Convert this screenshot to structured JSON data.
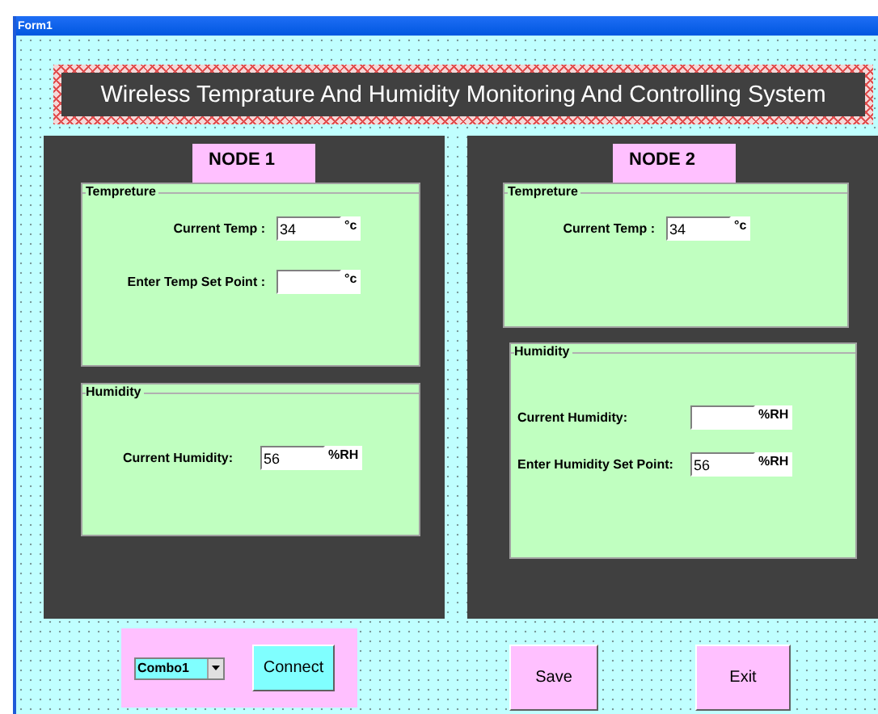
{
  "window": {
    "title": "Form1"
  },
  "banner": {
    "title": "Wireless Temprature And Humidity Monitoring And Controlling System"
  },
  "nodes": [
    {
      "name": "NODE 1",
      "groups": [
        {
          "title": "Tempreture",
          "fields": [
            {
              "label": "Current Temp :",
              "value": "34",
              "unit": "°c"
            },
            {
              "label": "Enter Temp Set Point :",
              "unit": "°c"
            }
          ]
        },
        {
          "title": "Humidity",
          "fields": [
            {
              "label": "Current Humidity:",
              "value": "56",
              "unit": "%RH"
            }
          ]
        }
      ]
    },
    {
      "name": "NODE 2",
      "groups": [
        {
          "title": "Tempreture",
          "fields": [
            {
              "label": "Current Temp :",
              "value": "34",
              "unit": "°c"
            }
          ]
        },
        {
          "title": "Humidity",
          "fields": [
            {
              "label": "Current Humidity:",
              "unit": "%RH"
            },
            {
              "label": "Enter Humidity Set Point:",
              "value": "56",
              "unit": "%RH"
            }
          ]
        }
      ]
    }
  ],
  "connection": {
    "combo": "Combo1",
    "button": "Connect"
  },
  "buttons": [
    "Save",
    "Exit"
  ]
}
